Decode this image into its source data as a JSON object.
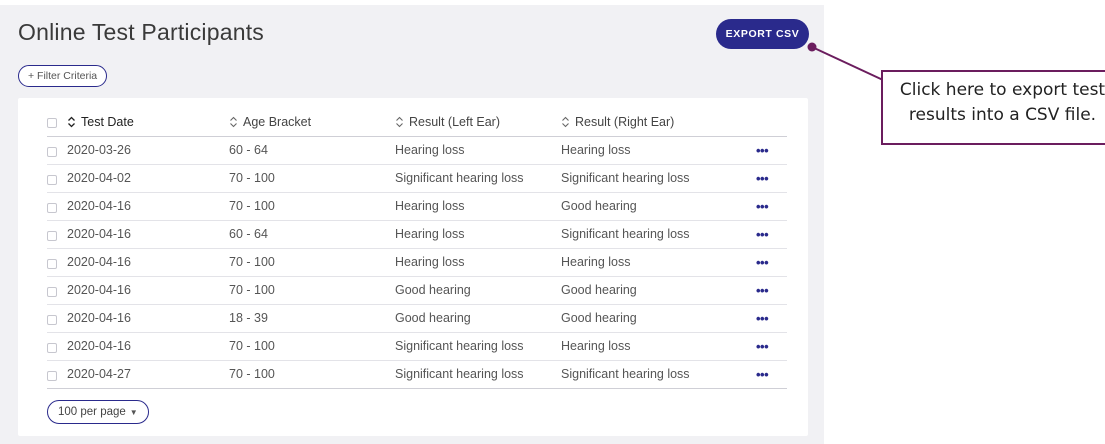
{
  "header": {
    "title": "Online Test Participants",
    "export_label": "EXPORT CSV"
  },
  "filter": {
    "label": "+ Filter Criteria"
  },
  "table": {
    "columns": [
      "Test Date",
      "Age Bracket",
      "Result (Left Ear)",
      "Result (Right Ear)"
    ],
    "rows": [
      [
        "2020-03-26",
        "60 - 64",
        "Hearing loss",
        "Hearing loss"
      ],
      [
        "2020-04-02",
        "70 - 100",
        "Significant hearing loss",
        "Significant hearing loss"
      ],
      [
        "2020-04-16",
        "70 - 100",
        "Hearing loss",
        "Good hearing"
      ],
      [
        "2020-04-16",
        "60 - 64",
        "Hearing loss",
        "Significant hearing loss"
      ],
      [
        "2020-04-16",
        "70 - 100",
        "Hearing loss",
        "Hearing loss"
      ],
      [
        "2020-04-16",
        "70 - 100",
        "Good hearing",
        "Good hearing"
      ],
      [
        "2020-04-16",
        "18 - 39",
        "Good hearing",
        "Good hearing"
      ],
      [
        "2020-04-16",
        "70 - 100",
        "Significant hearing loss",
        "Hearing loss"
      ],
      [
        "2020-04-27",
        "70 - 100",
        "Significant hearing loss",
        "Significant hearing loss"
      ]
    ],
    "row_action": "•••"
  },
  "pagination": {
    "per_page_label": "100 per page",
    "caret": "▼"
  },
  "callout": {
    "line1": "Click here to export test",
    "line2": "results into a CSV file."
  },
  "colors": {
    "accent": "#2a2a8c",
    "callout_border": "#6b1d5e",
    "panel_bg": "#f1f1f4"
  },
  "icons": {
    "sort": "sort-updown-icon",
    "more": "more-horizontal-icon",
    "caret": "caret-down-icon"
  }
}
